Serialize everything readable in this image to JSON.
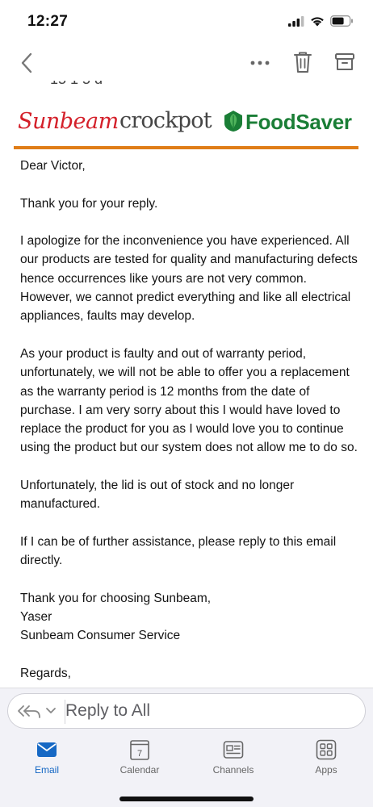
{
  "status_bar": {
    "time": "12:27"
  },
  "email": {
    "cut_text": "15 1 5 d",
    "brands": {
      "sunbeam": "Sunbeam",
      "crockpot": "crockpot",
      "foodsaver": "FoodSaver"
    },
    "paragraphs": [
      "Dear Victor,",
      "Thank you for your reply.",
      "I apologize for the inconvenience you have experienced. All our products are tested for quality and manufacturing defects hence occurrences like yours are not very common. However, we cannot predict everything and like all electrical appliances, faults may develop.",
      "As your product is faulty and out of warranty period, unfortunately, we will not be able to offer you a replacement as the warranty period is 12 months from the date of purchase. I am very sorry about this I would have loved to replace the product for you as I would love you to continue using the product but our system does not allow me to do so.",
      "Unfortunately, the lid is out of stock and no longer manufactured.",
      "If I can be of further assistance, please reply to this email directly.",
      "Thank you for choosing Sunbeam,\nYaser\nSunbeam Consumer Service",
      "Regards,"
    ]
  },
  "reply": {
    "label": "Reply to All"
  },
  "tabs": [
    {
      "label": "Email",
      "icon": "mail-icon",
      "active": true
    },
    {
      "label": "Calendar",
      "icon": "calendar-icon",
      "day": "7"
    },
    {
      "label": "Channels",
      "icon": "channels-icon"
    },
    {
      "label": "Apps",
      "icon": "apps-icon"
    }
  ],
  "colors": {
    "accent": "#1668c4",
    "brand_rule": "#e07d18",
    "sunbeam_red": "#d4202a",
    "foodsaver_green": "#1a7e36"
  }
}
